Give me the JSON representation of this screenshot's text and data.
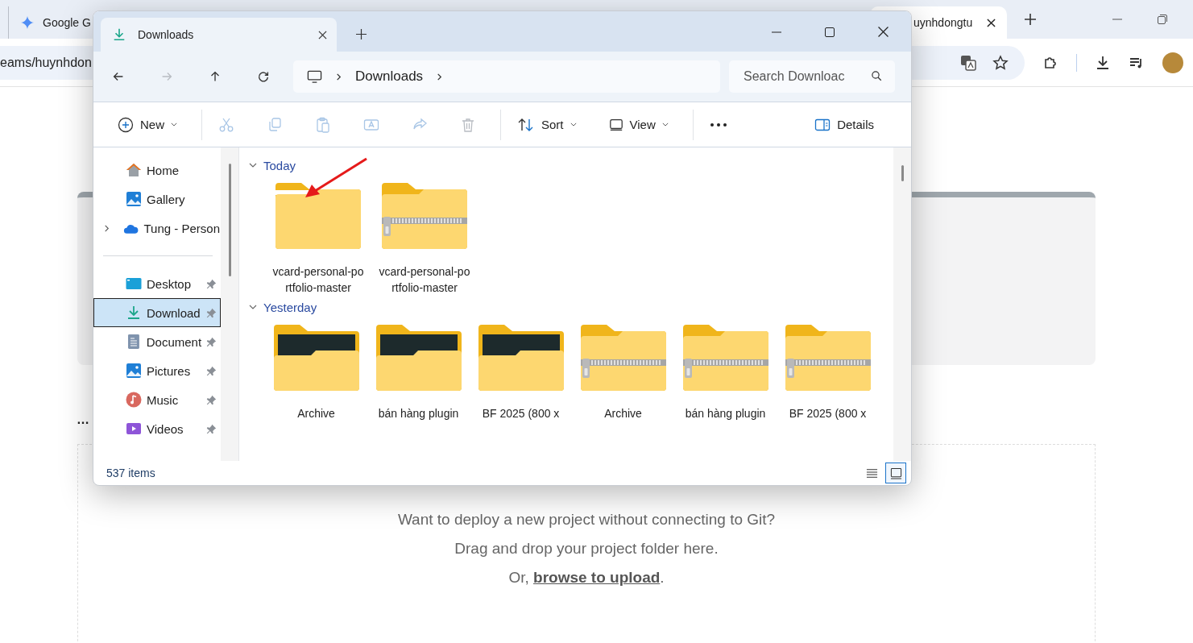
{
  "browser": {
    "tabs": [
      {
        "label": "Google G",
        "selected": false,
        "kind": "star"
      },
      {
        "label": "uynhdongtu",
        "selected": true,
        "kind": "page"
      }
    ],
    "address": "eams/huynhdon"
  },
  "page": {
    "ellipsis": "…",
    "dropzone": {
      "line_1": "Want to deploy a new project without connecting to Git?",
      "line_2": "Drag and drop your project folder here.",
      "prefix": "Or, ",
      "link": "browse to upload",
      "suffix": "."
    }
  },
  "explorer": {
    "tab": {
      "title": "Downloads"
    },
    "nav": [
      {
        "kind": "back",
        "disabled": false
      },
      {
        "kind": "forward",
        "disabled": true
      },
      {
        "kind": "up",
        "disabled": false
      },
      {
        "kind": "refresh",
        "disabled": false
      }
    ],
    "path": [
      "Downloads"
    ],
    "search": {
      "placeholder": "Search Downloac"
    },
    "toolbar": [
      {
        "kind": "new",
        "label": "New",
        "disabled": false
      },
      {
        "kind": "cut",
        "disabled": true
      },
      {
        "kind": "copy",
        "disabled": true
      },
      {
        "kind": "paste",
        "disabled": true
      },
      {
        "kind": "rename",
        "disabled": true
      },
      {
        "kind": "share",
        "disabled": true
      },
      {
        "kind": "delete",
        "disabled": true
      },
      {
        "kind": "sort",
        "label": "Sort"
      },
      {
        "kind": "view",
        "label": "View"
      },
      {
        "kind": "more"
      },
      {
        "kind": "details",
        "label": "Details"
      }
    ],
    "sidebar": {
      "top": [
        {
          "label": "Home",
          "kind": "home",
          "expandable": false,
          "selected": false
        },
        {
          "label": "Gallery",
          "kind": "gallery",
          "expandable": false,
          "selected": false
        },
        {
          "label": "Tung - Person",
          "kind": "cloud",
          "expandable": true,
          "selected": false
        }
      ],
      "pinned": [
        {
          "label": "Desktop",
          "kind": "desktop",
          "pinned": true,
          "selected": false
        },
        {
          "label": "Download",
          "kind": "download",
          "pinned": true,
          "selected": true
        },
        {
          "label": "Document",
          "kind": "document",
          "pinned": true,
          "selected": false
        },
        {
          "label": "Pictures",
          "kind": "pictures",
          "pinned": true,
          "selected": false
        },
        {
          "label": "Music",
          "kind": "music",
          "pinned": true,
          "selected": false
        },
        {
          "label": "Videos",
          "kind": "videos",
          "pinned": true,
          "selected": false
        }
      ]
    },
    "groups": [
      {
        "label": "Today",
        "expanded": true,
        "items": [
          {
            "name": "vcard-personal-portfolio-master",
            "kind": "folder"
          },
          {
            "name": "vcard-personal-portfolio-master",
            "kind": "zip"
          }
        ]
      },
      {
        "label": "Yesterday",
        "expanded": true,
        "items": [
          {
            "name": "Archive",
            "kind": "preview"
          },
          {
            "name": "bán hàng plugin",
            "kind": "preview"
          },
          {
            "name": "BF 2025 (800 x",
            "kind": "preview"
          },
          {
            "name": "Archive",
            "kind": "zip"
          },
          {
            "name": "bán hàng plugin",
            "kind": "zip"
          },
          {
            "name": "BF 2025 (800 x",
            "kind": "zip"
          }
        ]
      }
    ],
    "status": "537 items",
    "view_modes": [
      {
        "kind": "list",
        "selected": false
      },
      {
        "kind": "tiles",
        "selected": true
      }
    ]
  }
}
